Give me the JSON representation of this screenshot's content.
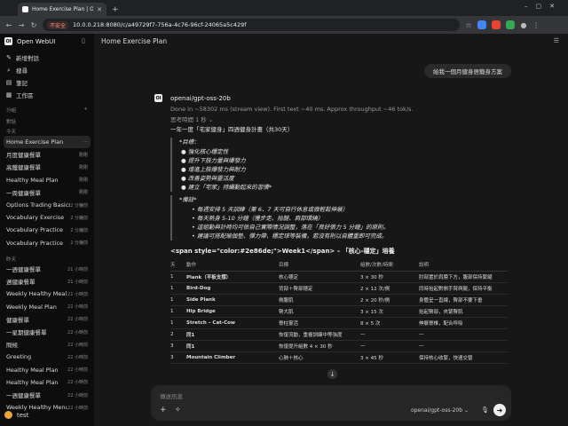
{
  "browser": {
    "tab_title": "Home Exercise Plan | Open WebUI",
    "insecure_label": "不安全",
    "url": "10.0.0.218:8080/c/a49729f7-756a-4c76-96cf-24065a5c429f"
  },
  "sidebar": {
    "brand": "Open WebUI",
    "menu": [
      {
        "icon": "✎",
        "label": "新增對話"
      },
      {
        "icon": "⌕",
        "label": "搜尋"
      },
      {
        "icon": "▤",
        "label": "筆記"
      },
      {
        "icon": "▦",
        "label": "工作區"
      }
    ],
    "section_folders": "分組",
    "section_chats": "對話",
    "section_today": "今天",
    "section_yesterday": "昨天",
    "today_chats": [
      {
        "name": "Home Exercise Plan",
        "time": "···",
        "active": true
      },
      {
        "name": "月度健康餐單",
        "time": "剛剛"
      },
      {
        "name": "高鐵健康餐單",
        "time": "剛剛"
      },
      {
        "name": "Healthy Meal Plan",
        "time": "剛剛"
      },
      {
        "name": "一周健康餐單",
        "time": "剛剛"
      },
      {
        "name": "Options Trading Basics",
        "time": "2 分鐘前"
      },
      {
        "name": "Vocabulary Exercise",
        "time": "2 分鐘前"
      },
      {
        "name": "Vocabulary Practice",
        "time": "2 分鐘前"
      },
      {
        "name": "Vocabulary Practice",
        "time": "2 分鐘前"
      }
    ],
    "yesterday_chats": [
      {
        "name": "一週健康餐單",
        "time": "21 小時前"
      },
      {
        "name": "週健康餐單",
        "time": "21 小時前"
      },
      {
        "name": "Weekly Healthy Meal P...",
        "time": "21 小時前"
      },
      {
        "name": "Weekly Meal Plan",
        "time": "22 小時前"
      },
      {
        "name": "健康餐單",
        "time": "22 小時前"
      },
      {
        "name": "一星期健康餐單",
        "time": "22 小時前"
      },
      {
        "name": "問候",
        "time": "22 小時前"
      },
      {
        "name": "Greeting",
        "time": "22 小時前"
      },
      {
        "name": "Healthy Meal Plan",
        "time": "22 小時前"
      },
      {
        "name": "Healthy Meal Plan",
        "time": "22 小時前"
      },
      {
        "name": "一週健康餐單",
        "time": "22 小時前"
      },
      {
        "name": "Weekly Healthy Menu",
        "time": "22 小時前"
      }
    ],
    "user_name": "test"
  },
  "main": {
    "title": "Home Exercise Plan",
    "user_message": "給我一個月健身居鍛身方案",
    "model_name": "openai/gpt-oss-20b",
    "meta": "Done in ~58302 ms (stream view). First text ~40 ms. Approx throughput ~46 tok/s.",
    "thinking": "思考時間 1 秒 ⌄",
    "heading": "一年一度「宅家健身」四週健身計畫（共30天）",
    "goals_heading": "*目標：",
    "goals": [
      "● 強化核心穩定性",
      "● 提升下肢力量與爆發力",
      "● 增進上肢爆發力與耐力",
      "● 改善姿勢與靈活度",
      "● 建立「宅家」持續動起來的習慣*"
    ],
    "notes_heading": "*備註*",
    "notes": [
      "• 每週安排 5 天訓練（第 6、7 天可自行休息或做輕鬆伸展）",
      "• 每天熱身 5-10 分鐘（慢步走、抬腿、肩部環繞）",
      "• 這組動與計時均可依自己實際情況調整，落在「良好張力 5 分鐘」的原則。",
      "• 建議可搭配瑜伽墊、彈力帶、穩定球等裝備，若沒有則以自體重即可完成。"
    ],
    "week_heading": "<span style=\"color:#2e86de;\">Week1</span> – 「核心-穩定」培養",
    "table_headers": [
      "天",
      "動作",
      "目標",
      "組數/次數/時間",
      "說明"
    ],
    "table_rows": [
      [
        "1",
        "Plank（平板支撐）",
        "核心穩定",
        "3 × 30 秒",
        "肘部置於肩膀下方，腹部保持緊縮"
      ],
      [
        "1",
        "Bird-Dog",
        "背部＋臀部穩定",
        "2 × 12 次/側",
        "同時抬起對側手臂與腿，保持平衡"
      ],
      [
        "1",
        "Side Plank",
        "側腹肌",
        "2 × 20 秒/側",
        "身體呈一直線，臀部不要下垂"
      ],
      [
        "1",
        "Hip Bridge",
        "臀大肌",
        "3 × 15 次",
        "抬起臀部，夾緊臀肌"
      ],
      [
        "1",
        "Stretch – Cat-Cow",
        "脊柱靈活",
        "8 × 5 次",
        "伸展脊椎，配合呼吸"
      ],
      [
        "2",
        "同1",
        "恢復流動，重複訓練中等強度",
        "—",
        "—"
      ],
      [
        "3",
        "同1",
        "恢復提升組數 4 × 30 秒",
        "—",
        "—"
      ],
      [
        "3",
        "Mountain Climber",
        "心肺＋核心",
        "3 × 45 秒",
        "保持核心收緊，快速交替"
      ]
    ],
    "input_placeholder": "傳送訊息",
    "selected_model": "openai/gpt-oss-20b ⌄"
  }
}
